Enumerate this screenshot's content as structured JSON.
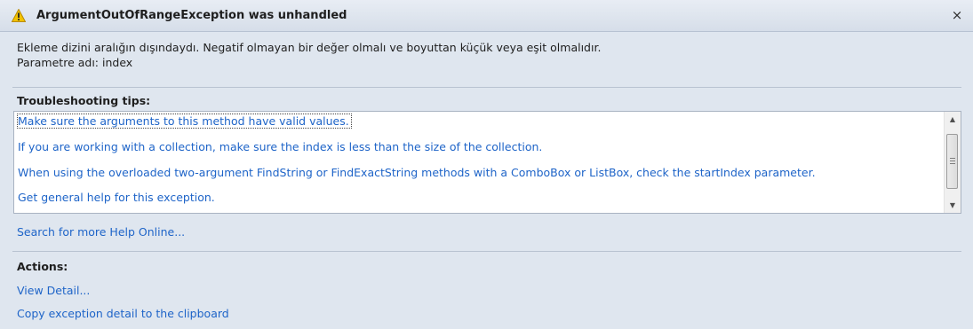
{
  "dialog": {
    "title": "ArgumentOutOfRangeException was unhandled",
    "close_label": "×"
  },
  "message": {
    "line1": "Ekleme dizini aralığın dışındaydı. Negatif olmayan bir değer olmalı ve boyuttan küçük veya eşit olmalıdır.",
    "line2": "Parametre adı: index"
  },
  "troubleshooting": {
    "heading": "Troubleshooting tips:",
    "tips": [
      "Make sure the arguments to this method have valid values.",
      "If you are working with a collection, make sure the index is less than the size of the collection.",
      "When using the overloaded two-argument FindString or FindExactString methods with a ComboBox or ListBox, check the startIndex parameter.",
      "Get general help for this exception."
    ],
    "search_online": "Search for more Help Online..."
  },
  "actions": {
    "heading": "Actions:",
    "items": [
      "View Detail...",
      "Copy exception detail to the clipboard"
    ]
  },
  "colors": {
    "link": "#1e64c8",
    "background": "#dfe6ef",
    "warning": "#f2c200"
  }
}
